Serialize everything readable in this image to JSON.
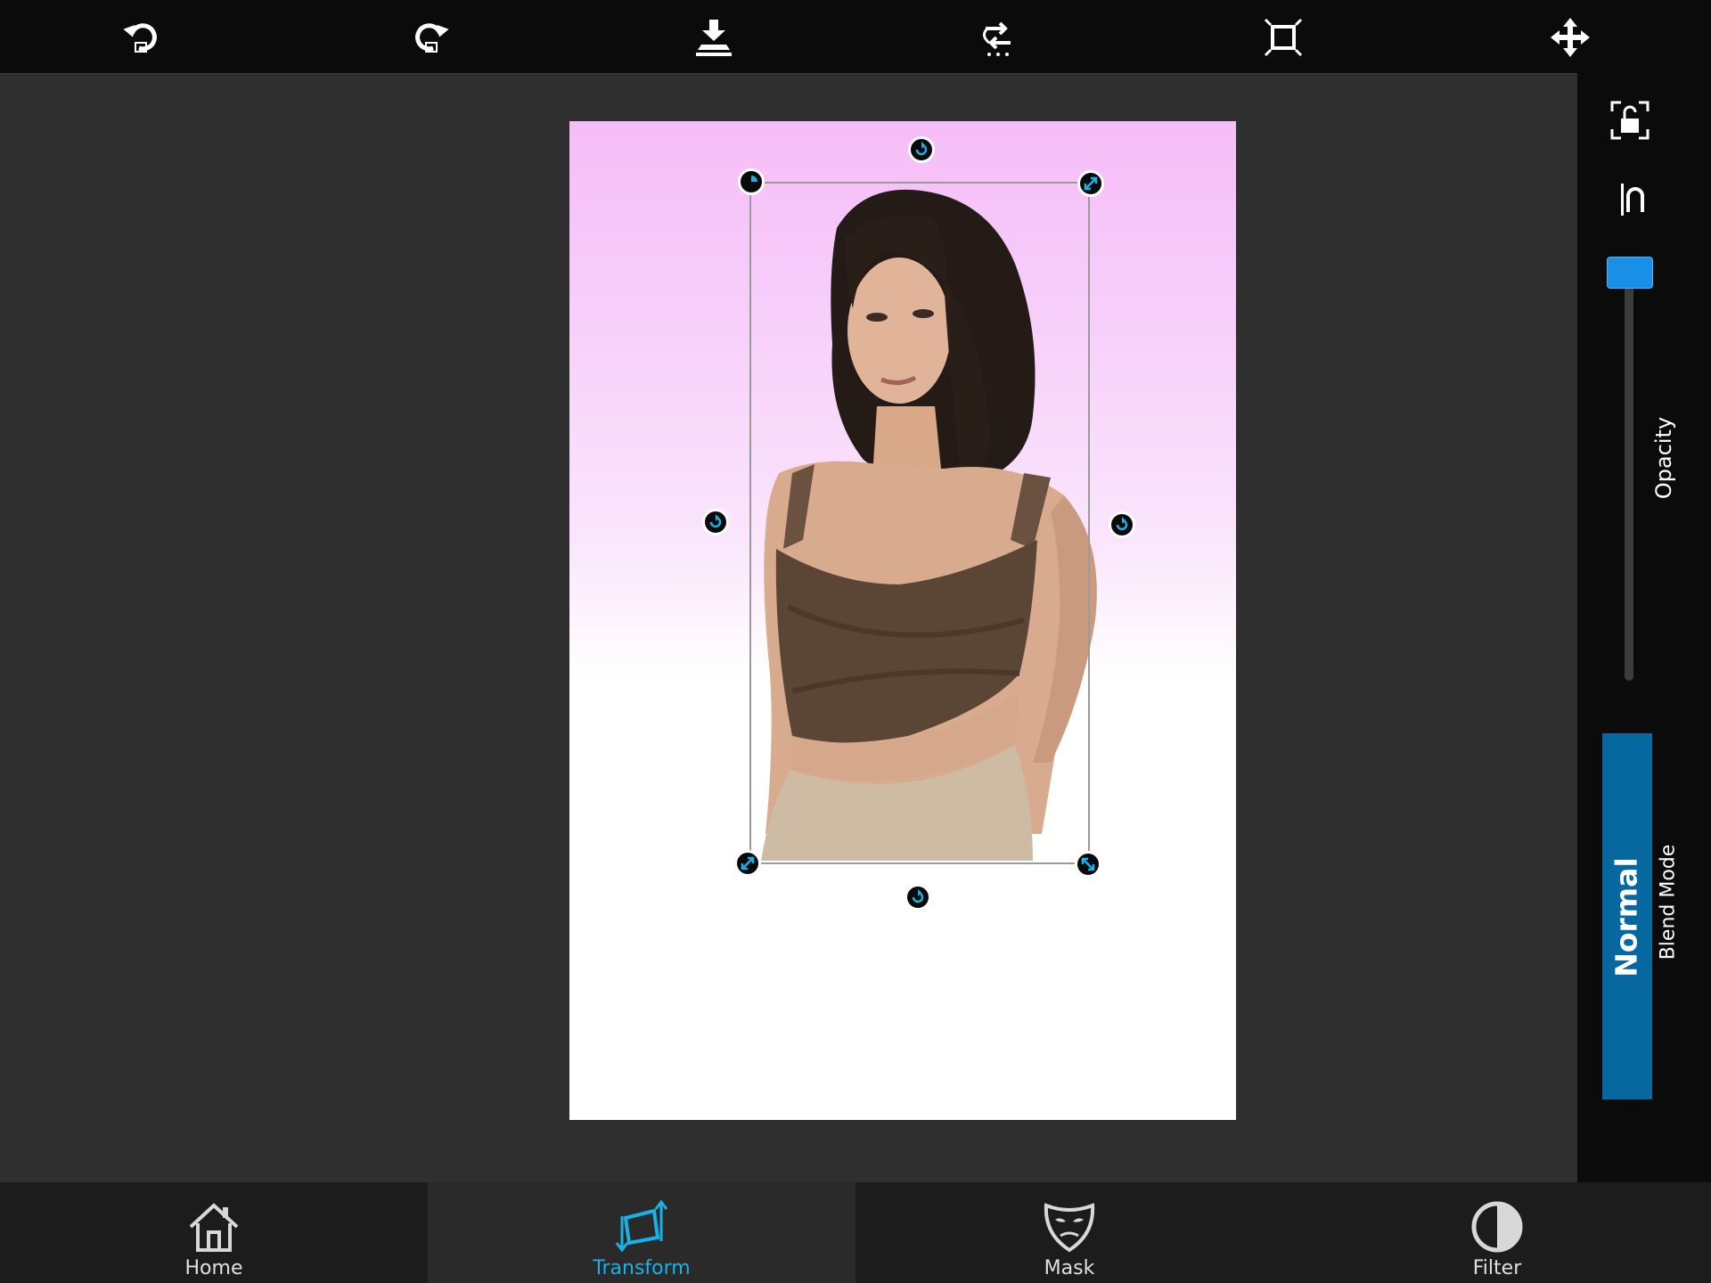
{
  "toolbar": {
    "tools": [
      {
        "name": "undo-icon"
      },
      {
        "name": "redo-icon"
      },
      {
        "name": "download-icon"
      },
      {
        "name": "flip-icon"
      },
      {
        "name": "fit-canvas-icon"
      },
      {
        "name": "move-icon"
      }
    ]
  },
  "right_panel": {
    "opacity_label": "Opacity",
    "opacity_value_fraction": 1.0,
    "blend_mode_label": "Blend Mode",
    "blend_mode_value": "Normal"
  },
  "bottom_nav": {
    "items": [
      {
        "label": "Home",
        "icon": "home-icon"
      },
      {
        "label": "Transform",
        "icon": "transform-icon",
        "active": true
      },
      {
        "label": "Mask",
        "icon": "mask-icon"
      },
      {
        "label": "Filter",
        "icon": "filter-icon"
      }
    ]
  },
  "colors": {
    "accent": "#1ab2e6",
    "blend_button": "#07689f",
    "slider_thumb": "#1a8fe8",
    "toolbar_bg": "#0b0b0b",
    "workspace_bg": "#2f2f2f"
  }
}
